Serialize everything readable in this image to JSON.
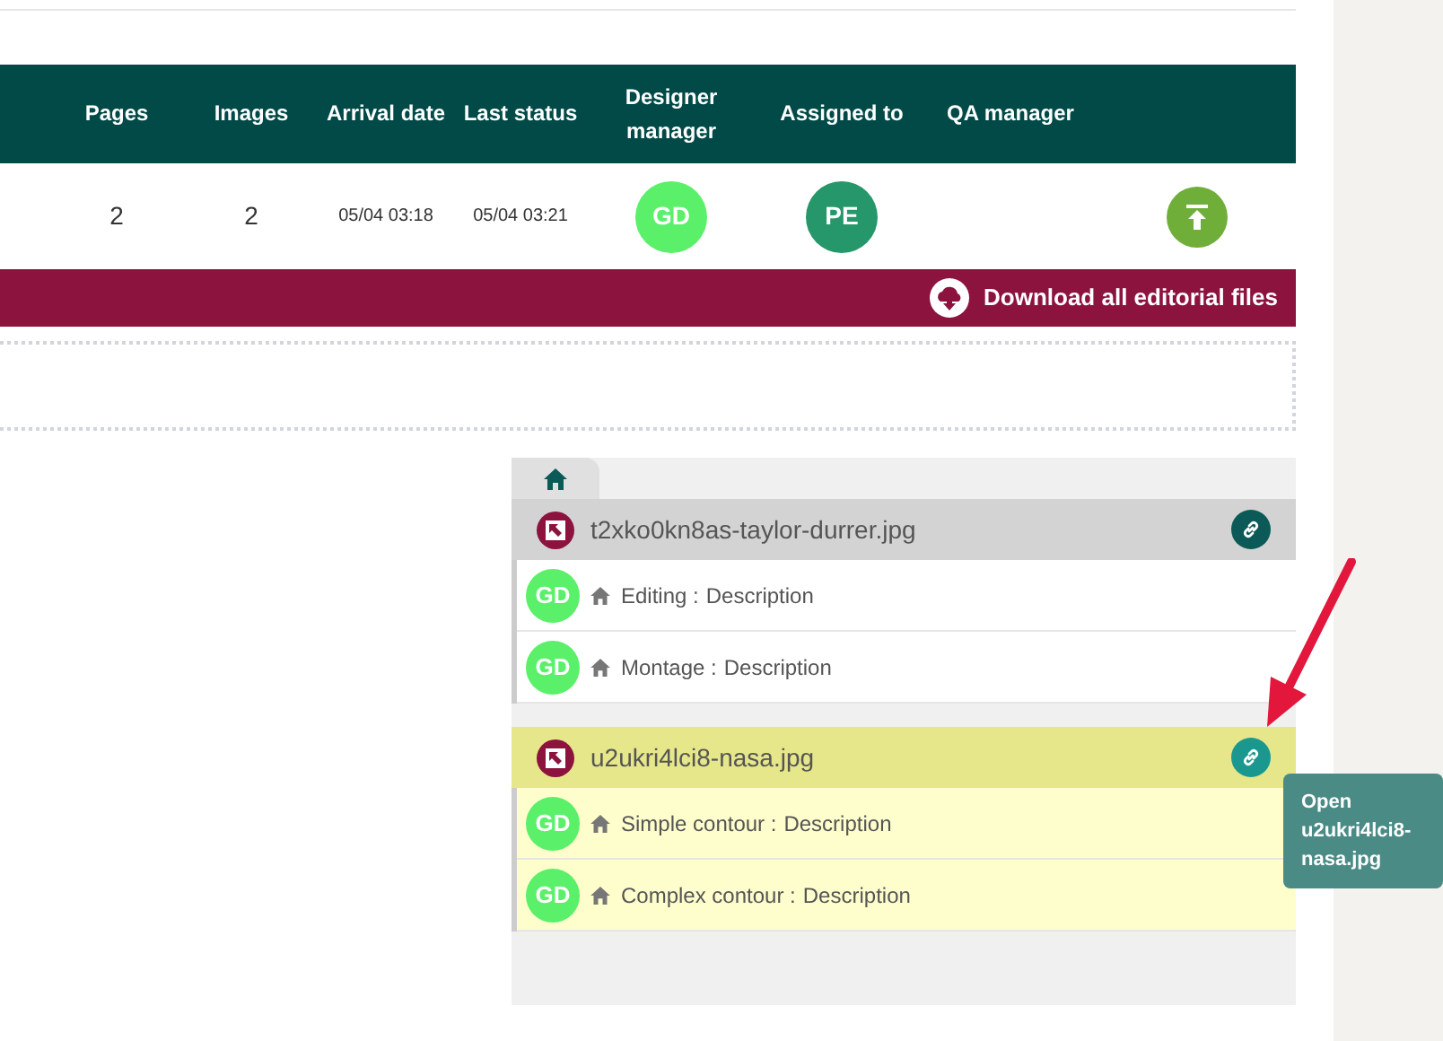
{
  "table": {
    "columns": [
      "Pages",
      "Images",
      "Arrival date",
      "Last status",
      "Designer manager",
      "Assigned to",
      "QA manager"
    ],
    "row": {
      "pages": "2",
      "images": "2",
      "arrival_date": "05/04 03:18",
      "last_status": "05/04 03:21",
      "designer_manager": {
        "initials": "GD",
        "color": "#5af06a"
      },
      "assigned_to": {
        "initials": "PE",
        "color": "#26976a"
      }
    }
  },
  "download_bar": {
    "label": "Download all editorial files"
  },
  "files": [
    {
      "name": "t2xko0kn8as-taylor-durrer.jpg",
      "selected": false,
      "tasks": [
        {
          "avatar": "GD",
          "label": "Editing :",
          "description": "Description"
        },
        {
          "avatar": "GD",
          "label": "Montage :",
          "description": "Description"
        }
      ]
    },
    {
      "name": "u2ukri4lci8-nasa.jpg",
      "selected": true,
      "tasks": [
        {
          "avatar": "GD",
          "label": "Simple contour :",
          "description": "Description"
        },
        {
          "avatar": "GD",
          "label": "Complex contour :",
          "description": "Description"
        }
      ]
    }
  ],
  "tooltip": {
    "text": "Open u2ukri4lci8-nasa.jpg"
  }
}
